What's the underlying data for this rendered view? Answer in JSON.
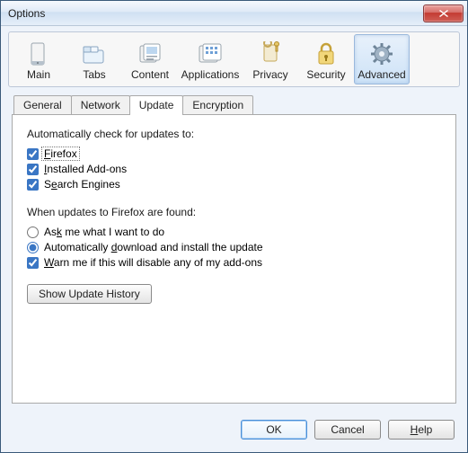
{
  "window": {
    "title": "Options"
  },
  "toolbar": {
    "items": [
      {
        "label": "Main"
      },
      {
        "label": "Tabs"
      },
      {
        "label": "Content"
      },
      {
        "label": "Applications"
      },
      {
        "label": "Privacy"
      },
      {
        "label": "Security"
      },
      {
        "label": "Advanced"
      }
    ],
    "selected_index": 6
  },
  "tabs": {
    "items": [
      {
        "label": "General"
      },
      {
        "label": "Network"
      },
      {
        "label": "Update"
      },
      {
        "label": "Encryption"
      }
    ],
    "active_index": 2
  },
  "update_panel": {
    "auto_check_label": "Automatically check for updates to:",
    "check_firefox": {
      "label": "Firefox",
      "mnemonic": "F",
      "checked": true
    },
    "check_addons": {
      "label": "Installed Add-ons",
      "mnemonic": "I",
      "checked": true
    },
    "check_search": {
      "label": "Search Engines",
      "mnemonic": "e",
      "checked": true
    },
    "found_label": "When updates to Firefox are found:",
    "radio_ask": {
      "label": "Ask me what I want to do",
      "mnemonic": "k",
      "selected": false
    },
    "radio_auto": {
      "label": "Automatically download and install the update",
      "mnemonic": "d",
      "selected": true
    },
    "warn_disable": {
      "label": "Warn me if this will disable any of my add-ons",
      "mnemonic": "W",
      "checked": true
    },
    "history_btn": "Show Update History"
  },
  "footer": {
    "ok": "OK",
    "cancel": "Cancel",
    "help": "Help",
    "help_mnemonic": "H"
  }
}
